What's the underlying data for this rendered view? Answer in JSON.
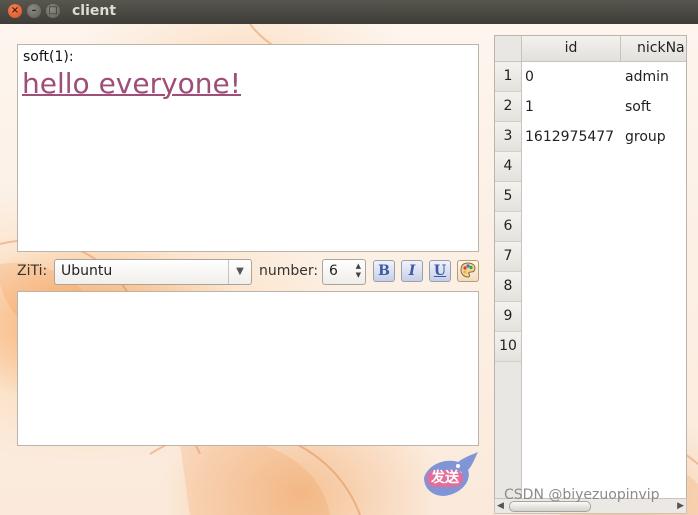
{
  "window": {
    "title": "client",
    "close_glyph": "×",
    "min_glyph": "–",
    "max_glyph": "□"
  },
  "chat": {
    "sender": "soft(1):",
    "message": "hello everyone!",
    "message_color": "#9e4e78"
  },
  "toolbar": {
    "font_label": "ZiTi:",
    "font_value": "Ubuntu",
    "size_label": "number:",
    "size_value": "6",
    "bold_icon": "B",
    "italic_icon": "I",
    "underline_icon": "U",
    "color_icon": "palette-icon"
  },
  "send_button": {
    "label": "发送"
  },
  "user_table": {
    "columns": [
      "id",
      "nickNa"
    ],
    "row_numbers": [
      "1",
      "2",
      "3",
      "4",
      "5",
      "6",
      "7",
      "8",
      "9",
      "10"
    ],
    "rows": [
      [
        "0",
        "admin"
      ],
      [
        "1",
        "soft"
      ],
      [
        "1612975477",
        "group"
      ]
    ]
  },
  "watermark": "CSDN @biyezuopinvip"
}
